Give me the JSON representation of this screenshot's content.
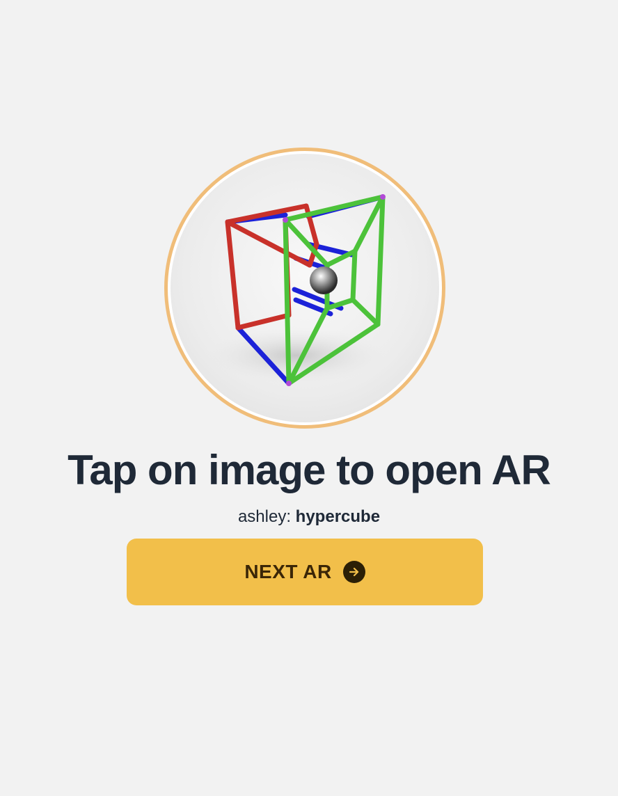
{
  "viewer": {
    "image_alt": "hypercube",
    "frame_color": "#f0bd79"
  },
  "headline": "Tap on image to open AR",
  "attribution": {
    "author": "ashley",
    "separator": ":",
    "model": "hypercube"
  },
  "next_button": {
    "label": "NEXT AR",
    "icon": "arrow-right-circle-icon",
    "color": "#f2bf4a"
  },
  "colors": {
    "background": "#f2f2f2",
    "text": "#1f2937",
    "edge_red": "#c8312a",
    "edge_blue": "#1c22d8",
    "edge_green": "#4cc23a"
  }
}
